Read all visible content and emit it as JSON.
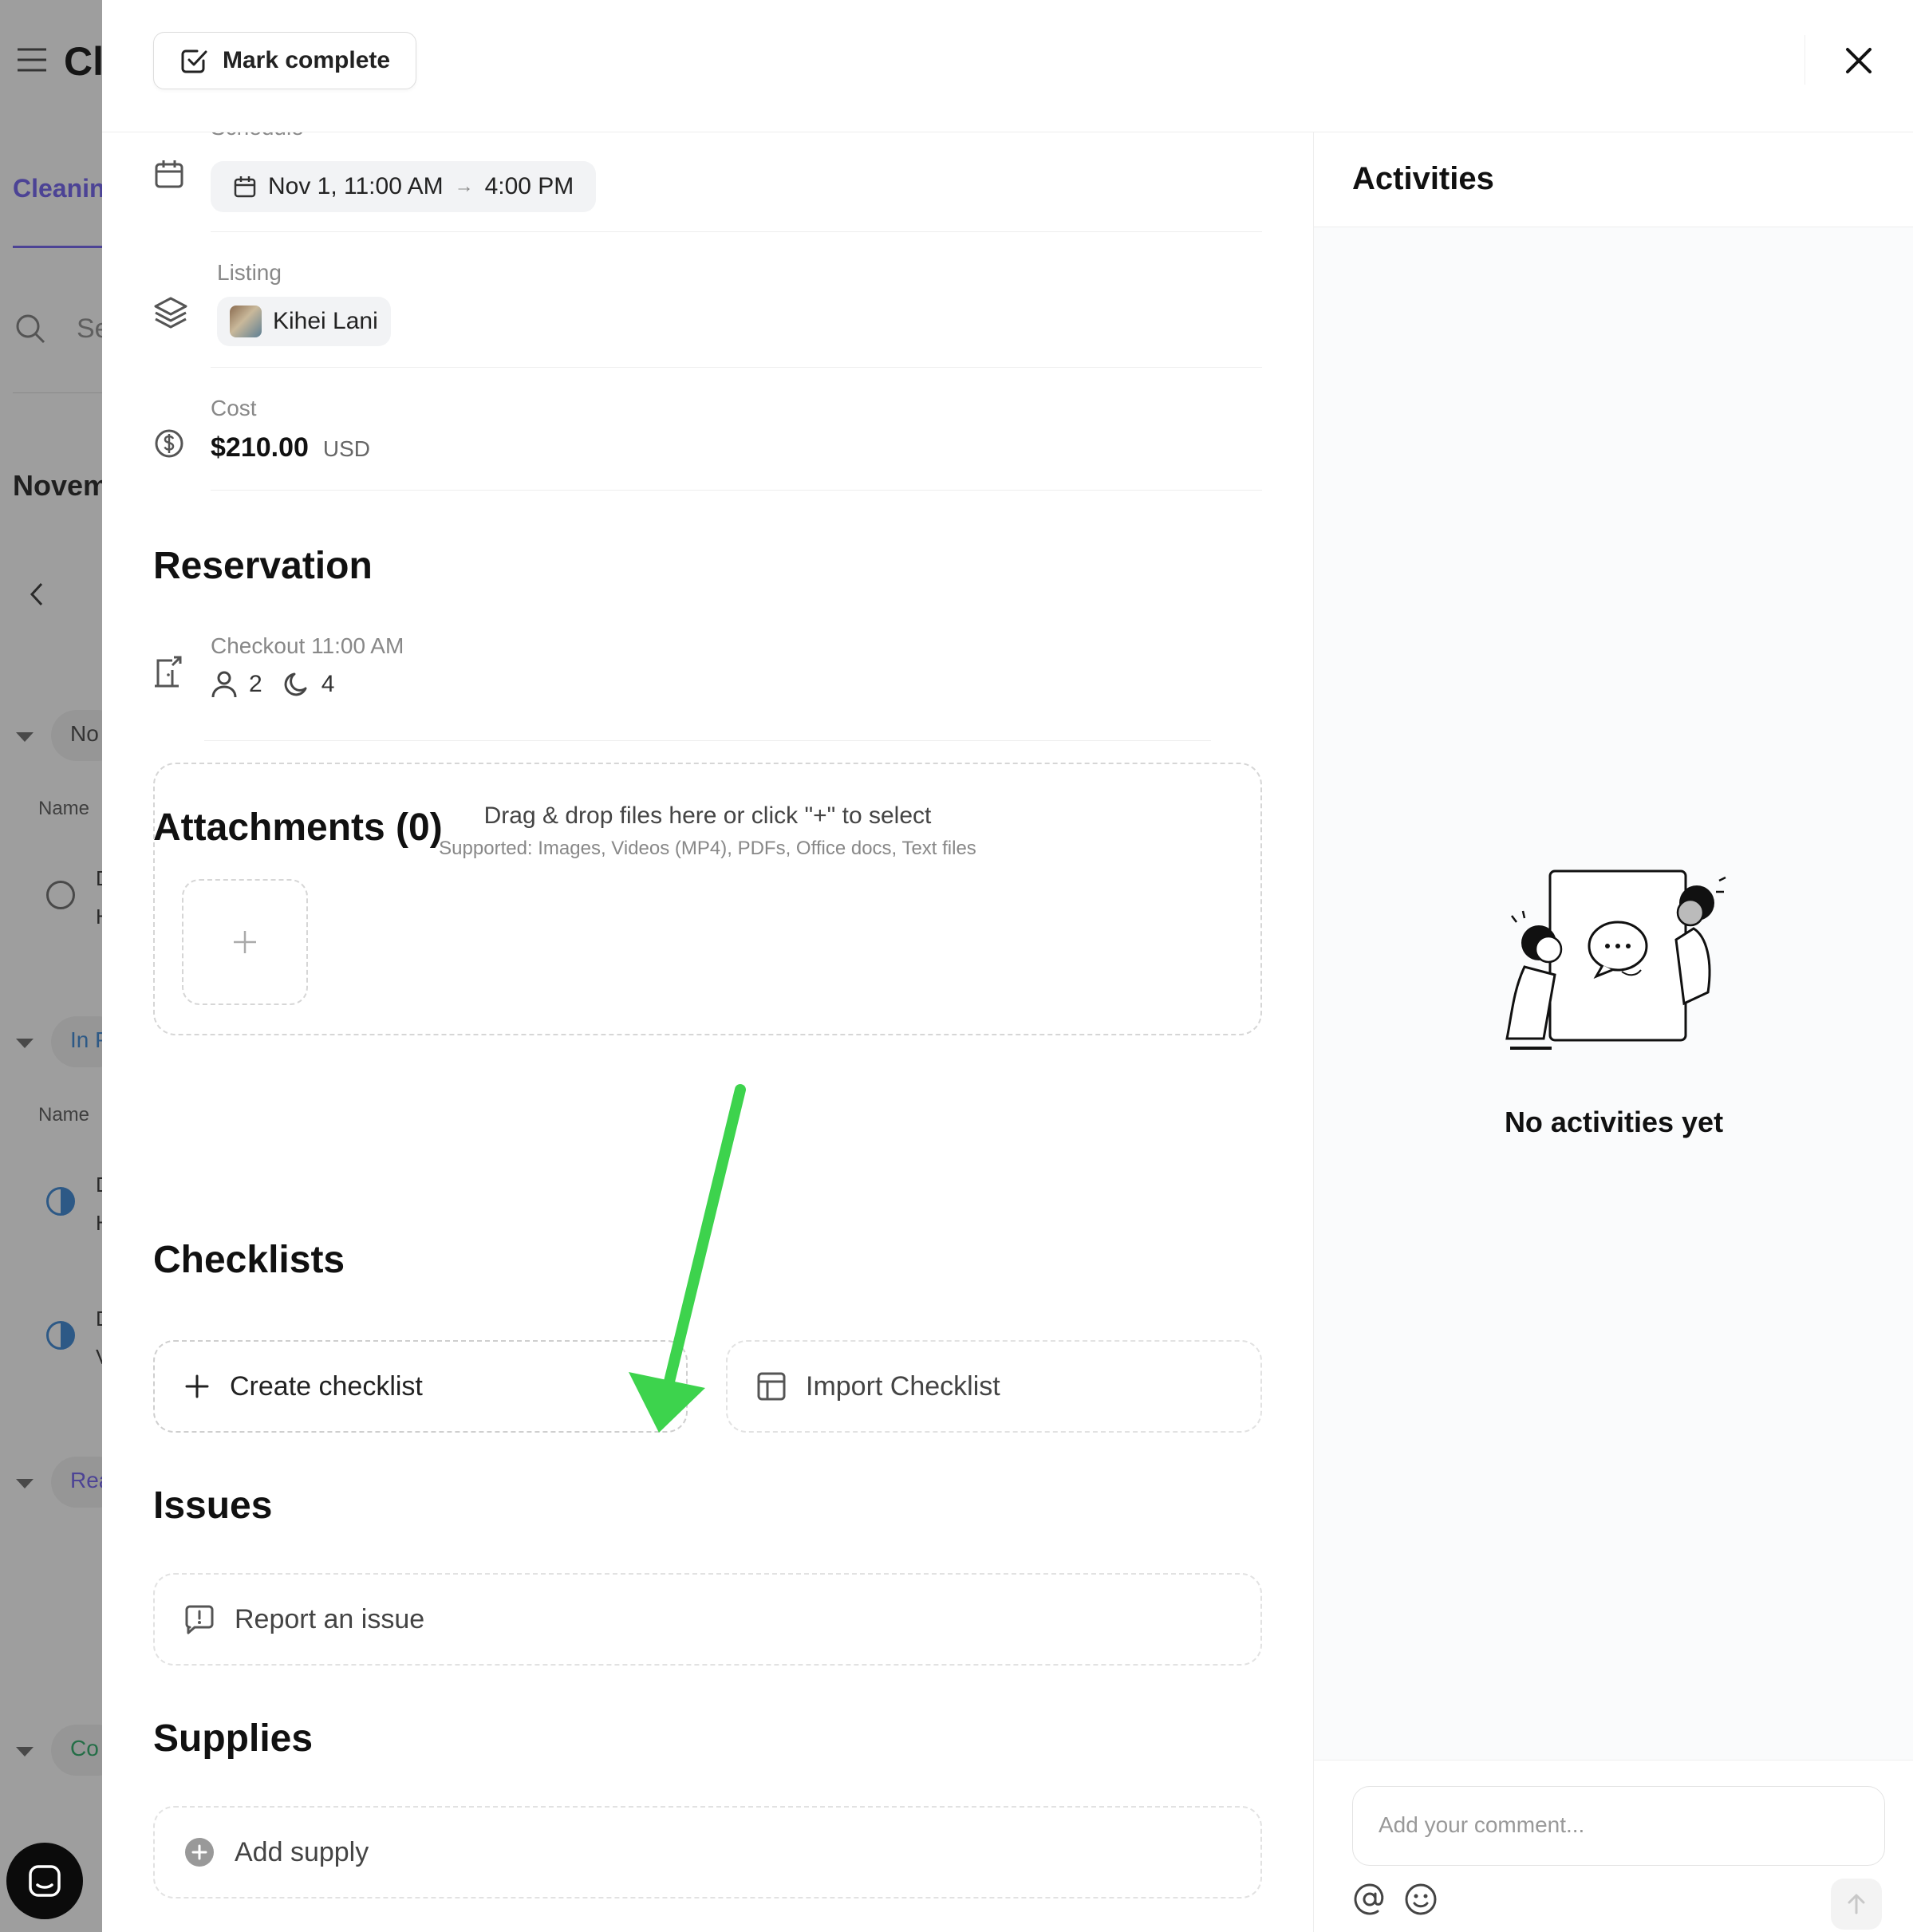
{
  "background": {
    "app_title": "Cl",
    "tab": "Cleanin",
    "search_placeholder": "Se",
    "month": "Novem",
    "groups": [
      {
        "label": "No",
        "color": "#555555"
      },
      {
        "label": "In P",
        "color": "#4a90d9"
      },
      {
        "label": "Rea",
        "color": "#7b6cf0"
      },
      {
        "label": "Co",
        "color": "#3bb273"
      }
    ],
    "column_header": "Name",
    "row_letters": [
      "D",
      "H",
      "D",
      "H",
      "D",
      "V"
    ]
  },
  "header": {
    "mark_complete_label": "Mark complete"
  },
  "details": {
    "schedule": {
      "label": "Schedule",
      "start": "Nov 1, 11:00 AM",
      "arrow": "→",
      "end": "4:00 PM"
    },
    "listing": {
      "label": "Listing",
      "name": "Kihei Lani"
    },
    "cost": {
      "label": "Cost",
      "amount": "$210.00",
      "currency": "USD"
    }
  },
  "reservation": {
    "title": "Reservation",
    "checkout": "Checkout 11:00 AM",
    "guests": "2",
    "nights": "4"
  },
  "attachments": {
    "title": "Attachments (0)",
    "drop_text": "Drag & drop files here or click \"+\" to select",
    "supported_text": "Supported: Images, Videos (MP4), PDFs, Office docs, Text files"
  },
  "checklists": {
    "title": "Checklists",
    "create_label": "Create checklist",
    "import_label": "Import Checklist"
  },
  "issues": {
    "title": "Issues",
    "report_label": "Report an issue"
  },
  "supplies": {
    "title": "Supplies",
    "add_label": "Add supply"
  },
  "activities": {
    "title": "Activities",
    "empty_text": "No activities yet",
    "comment_placeholder": "Add your comment..."
  },
  "annotation": {
    "arrow_color": "#3dd34d"
  }
}
